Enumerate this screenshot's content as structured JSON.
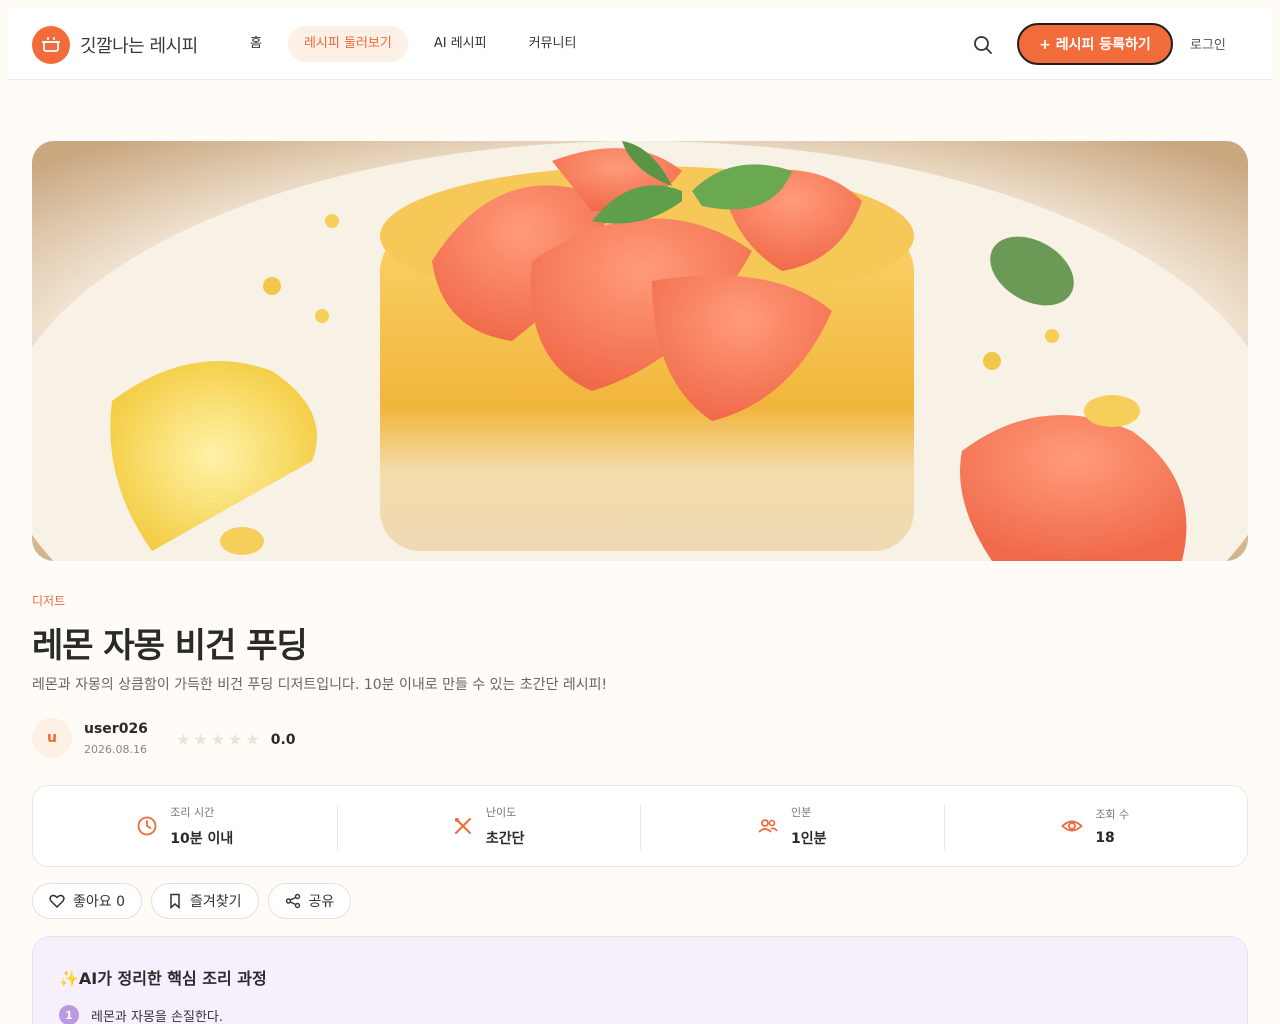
{
  "header": {
    "logo_text": "깃깔나는 레시피",
    "nav": [
      {
        "label": "홈",
        "active": false
      },
      {
        "label": "레시피 둘러보기",
        "active": true
      },
      {
        "label": "AI 레시피",
        "active": false
      },
      {
        "label": "커뮤니티",
        "active": false
      }
    ],
    "register_label": "+ 레시피 등록하기",
    "login_label": "로그인"
  },
  "hero": {
    "image": "lemon-grapefruit-pudding-photo"
  },
  "recipe": {
    "category": "디저트",
    "title": "레몬 자몽 비건 푸딩",
    "description": "레몬과 자몽의 상큼함이 가득한 비건 푸딩 디저트입니다. 10분 이내로 만들 수 있는 초간단 레시피!"
  },
  "author": {
    "initial": "u",
    "name": "user026",
    "date": "2026.08.16",
    "rating": "0.0",
    "stars": 0
  },
  "stats": [
    {
      "icon": "clock-icon",
      "label": "조리 시간",
      "value": "10분 이내"
    },
    {
      "icon": "utensils-icon",
      "label": "난이도",
      "value": "초간단"
    },
    {
      "icon": "people-icon",
      "label": "인분",
      "value": "1인분"
    },
    {
      "icon": "eye-icon",
      "label": "조회 수",
      "value": "18"
    }
  ],
  "actions": {
    "like_label": "좋아요 0",
    "bookmark_label": "즐겨찾기",
    "share_label": "공유"
  },
  "ai_summary": {
    "title": "✨AI가 정리한 핵심 조리 과정",
    "steps": [
      {
        "num": "1",
        "text": "레몬과 자몽을 손질한다."
      }
    ]
  },
  "colors": {
    "accent": "#f26b3a",
    "background": "#fffcf7",
    "ai_box": "#f5f0fb"
  }
}
